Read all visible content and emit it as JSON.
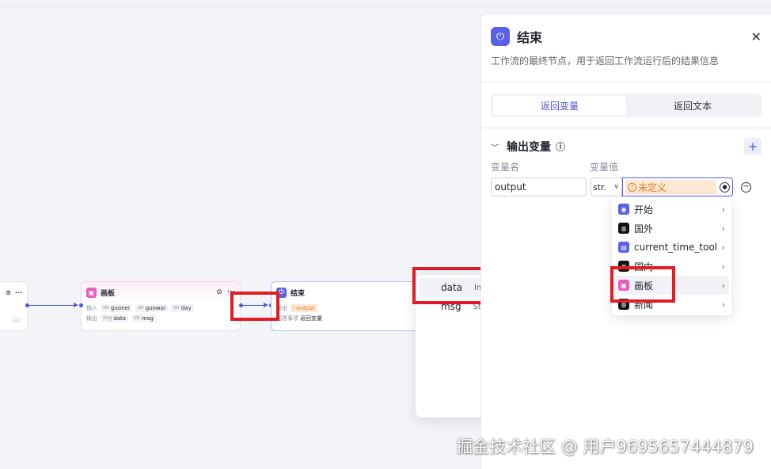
{
  "colors": {
    "accent": "#4e57d6",
    "brand_end": "#5b5fe8",
    "board_pink": "#e85cc0",
    "warn_orange": "#e07a1f",
    "highlight_red": "#e31b23"
  },
  "nodes": {
    "start": {
      "icons": [
        "target-icon",
        "more-icon"
      ],
      "more": "..."
    },
    "board": {
      "title": "画板",
      "input_label": "输入",
      "inputs": [
        {
          "type": "str",
          "name": "guonei"
        },
        {
          "type": "str",
          "name": "guowai"
        },
        {
          "type": "str",
          "name": "day"
        }
      ],
      "output_label": "输出",
      "outputs": [
        {
          "type": "img",
          "name": "data"
        },
        {
          "type": "str",
          "name": "msg"
        }
      ]
    },
    "end": {
      "title": "结束",
      "output_label": "输出",
      "output_tag": "output",
      "answer_label": "回答事项",
      "answer_value": "返回变量"
    }
  },
  "var_popup": {
    "items": [
      {
        "name": "data",
        "type": "Image"
      },
      {
        "name": "msg",
        "type": "String"
      }
    ]
  },
  "panel": {
    "title": "结束",
    "description": "工作流的最终节点，用于返回工作流运行后的结果信息",
    "tabs": [
      "返回变量",
      "返回文本"
    ],
    "section_title": "输出变量",
    "col_name": "变量名",
    "col_value": "变量值",
    "row": {
      "name": "output",
      "type": "str.",
      "value": "未定义"
    }
  },
  "node_list": {
    "items": [
      {
        "label": "开始",
        "icon": "start-icon"
      },
      {
        "label": "国外",
        "icon": "plugin-icon"
      },
      {
        "label": "current_time_tool",
        "icon": "tool-icon"
      },
      {
        "label": "国内",
        "icon": "plugin-icon"
      },
      {
        "label": "画板",
        "icon": "board-icon"
      },
      {
        "label": "新闻",
        "icon": "plugin-icon"
      }
    ]
  },
  "watermark": "掘金技术社区 @ 用户9695657444879"
}
